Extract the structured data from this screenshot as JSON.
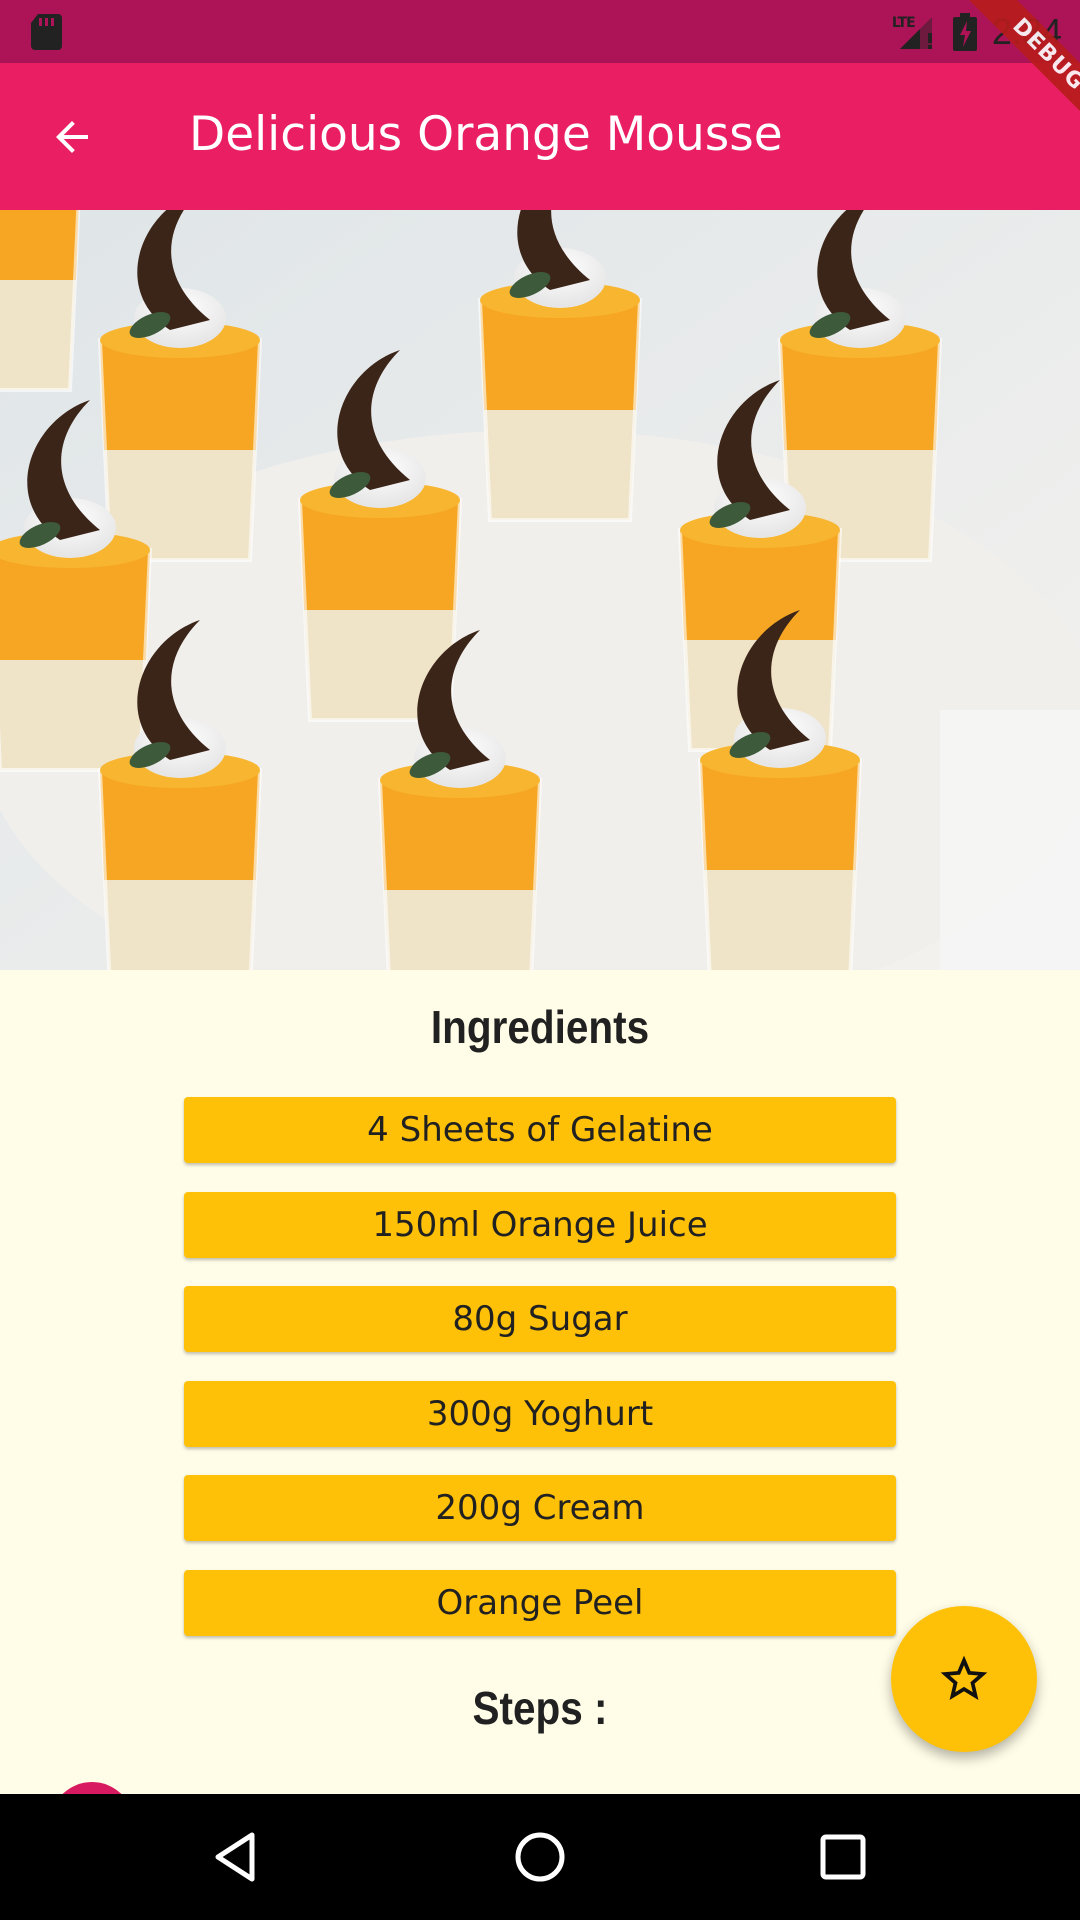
{
  "status_bar": {
    "time": "2:34",
    "network": "LTE",
    "icons": [
      "sd-card-icon",
      "signal-icon",
      "battery-charging-icon"
    ]
  },
  "app_bar": {
    "title": "Delicious Orange Mousse",
    "back_icon": "arrow-back-icon",
    "color": "#E91E63",
    "debug_label": "DEBUG"
  },
  "hero": {
    "icon": "dessert-photo"
  },
  "ingredients": {
    "title": "Ingredients",
    "items": [
      "4 Sheets of Gelatine",
      "150ml Orange Juice",
      "80g Sugar",
      "300g Yoghurt",
      "200g Cream",
      "Orange Peel"
    ]
  },
  "steps": {
    "title": "Steps :"
  },
  "fab": {
    "icon": "star-outline-icon",
    "color": "#FFC107"
  },
  "nav": {
    "icons": [
      "back-triangle-icon",
      "home-circle-icon",
      "recents-square-icon"
    ]
  },
  "colors": {
    "accent": "#FFC107",
    "primary": "#E91E63",
    "primary_dark": "#AD1457",
    "background": "#FFFDE7"
  }
}
